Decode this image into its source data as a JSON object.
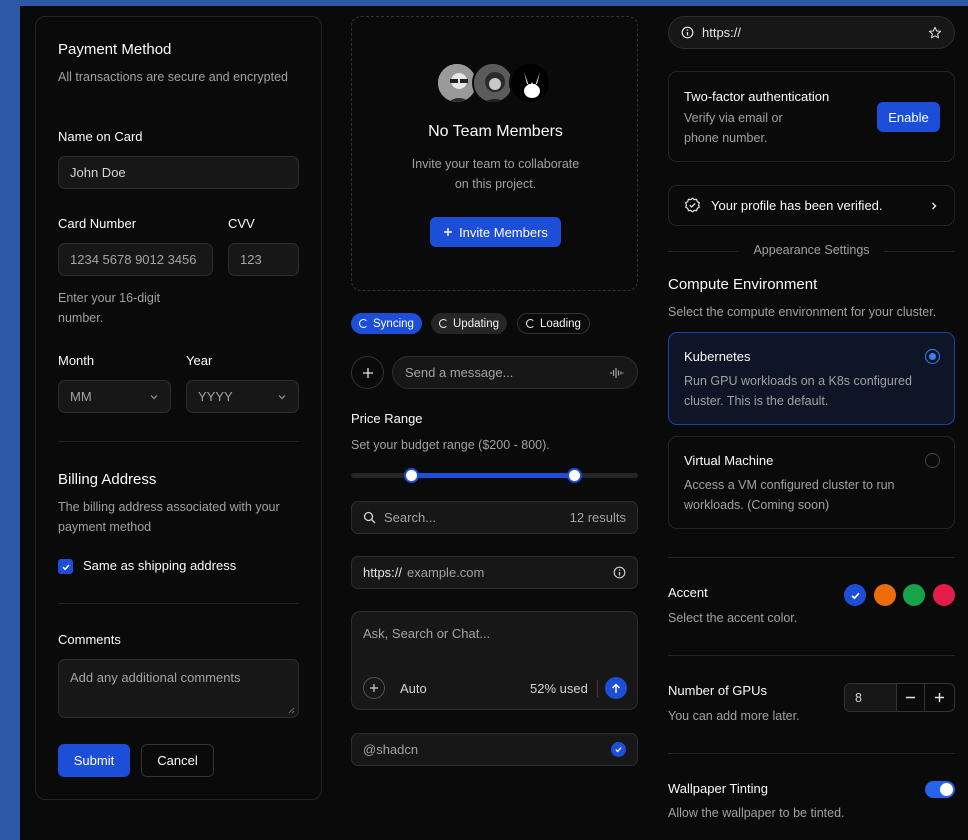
{
  "payment": {
    "title": "Payment Method",
    "subtitle": "All transactions are secure and encrypted",
    "name_label": "Name on Card",
    "name_value": "John Doe",
    "card_label": "Card Number",
    "card_placeholder": "1234 5678 9012 3456",
    "cvv_label": "CVV",
    "cvv_placeholder": "123",
    "card_hint": "Enter your 16-digit number.",
    "month_label": "Month",
    "month_value": "MM",
    "year_label": "Year",
    "year_value": "YYYY",
    "billing_title": "Billing Address",
    "billing_subtitle": "The billing address associated with your payment method",
    "same_address_label": "Same as shipping address",
    "same_address_checked": true,
    "comments_label": "Comments",
    "comments_placeholder": "Add any additional comments",
    "submit_label": "Submit",
    "cancel_label": "Cancel"
  },
  "team": {
    "title": "No Team Members",
    "subtitle": "Invite your team to collaborate on this project.",
    "invite_label": "Invite Members"
  },
  "badges": [
    "Syncing",
    "Updating",
    "Loading"
  ],
  "message": {
    "placeholder": "Send a message..."
  },
  "price": {
    "title": "Price Range",
    "subtitle": "Set your budget range ($200 - 800).",
    "min_fraction": 0.21,
    "max_fraction": 0.78
  },
  "search": {
    "placeholder": "Search...",
    "results": "12 results"
  },
  "url": {
    "prefix": "https://",
    "placeholder": "example.com"
  },
  "chat": {
    "placeholder": "Ask, Search or Chat...",
    "mode": "Auto",
    "usage": "52% used"
  },
  "username": {
    "value": "@shadcn"
  },
  "browser": {
    "url": "https://"
  },
  "twofa": {
    "title": "Two-factor authentication",
    "subtitle": "Verify via email or phone number.",
    "enable_label": "Enable"
  },
  "verified": {
    "label": "Your profile has been verified."
  },
  "appearance": {
    "separator": "Appearance Settings"
  },
  "compute": {
    "title": "Compute Environment",
    "subtitle": "Select the compute environment for your cluster.",
    "options": [
      {
        "title": "Kubernetes",
        "desc": "Run GPU workloads on a K8s configured cluster. This is the default.",
        "selected": true
      },
      {
        "title": "Virtual Machine",
        "desc": "Access a VM configured cluster to run workloads. (Coming soon)",
        "selected": false
      }
    ]
  },
  "accent": {
    "title": "Accent",
    "subtitle": "Select the accent color.",
    "colors": [
      "#1d4ed8",
      "#ea6c0a",
      "#16a34a",
      "#e11d48"
    ],
    "selected_index": 0
  },
  "gpus": {
    "title": "Number of GPUs",
    "subtitle": "You can add more later.",
    "value": "8"
  },
  "wallpaper": {
    "title": "Wallpaper Tinting",
    "subtitle": "Allow the wallpaper to be tinted.",
    "enabled": true
  }
}
